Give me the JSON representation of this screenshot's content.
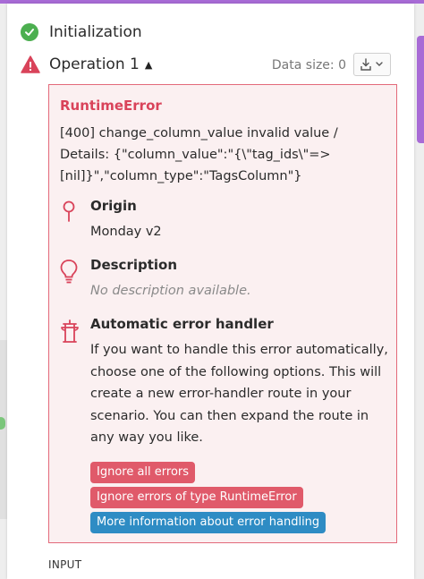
{
  "header": {
    "initialization_label": "Initialization",
    "operation_label": "Operation 1",
    "data_size_label": "Data size: 0"
  },
  "error": {
    "type": "RuntimeError",
    "message": "[400] change_column_value invalid value / Details: {\"column_value\":\"{\\\"tag_ids\\\"=> [nil]}\",\"column_type\":\"TagsColumn\"}",
    "origin_title": "Origin",
    "origin_value": "Monday v2",
    "description_title": "Description",
    "description_value": "No description available.",
    "handler_title": "Automatic error handler",
    "handler_text": "If you want to handle this error automatically, choose one of the following options. This will create a new error-handler route in your scenario. You can then expand the route in any way you like."
  },
  "buttons": {
    "ignore_all": "Ignore all errors",
    "ignore_type": "Ignore errors of type RuntimeError",
    "more_info": "More information about error handling"
  },
  "footer": {
    "input_label": "INPUT"
  },
  "colors": {
    "success": "#4caf50",
    "error": "#d9435a",
    "error_bg": "#fbf0f1",
    "button_red": "#e05a6a",
    "button_blue": "#2e8cc4",
    "accent": "#a86bd6"
  },
  "icons": {
    "initialization": "check-circle-icon",
    "operation": "warning-icon",
    "download": "download-icon",
    "origin": "pin-icon",
    "description": "lightbulb-icon",
    "handler": "fire-hydrant-icon"
  }
}
